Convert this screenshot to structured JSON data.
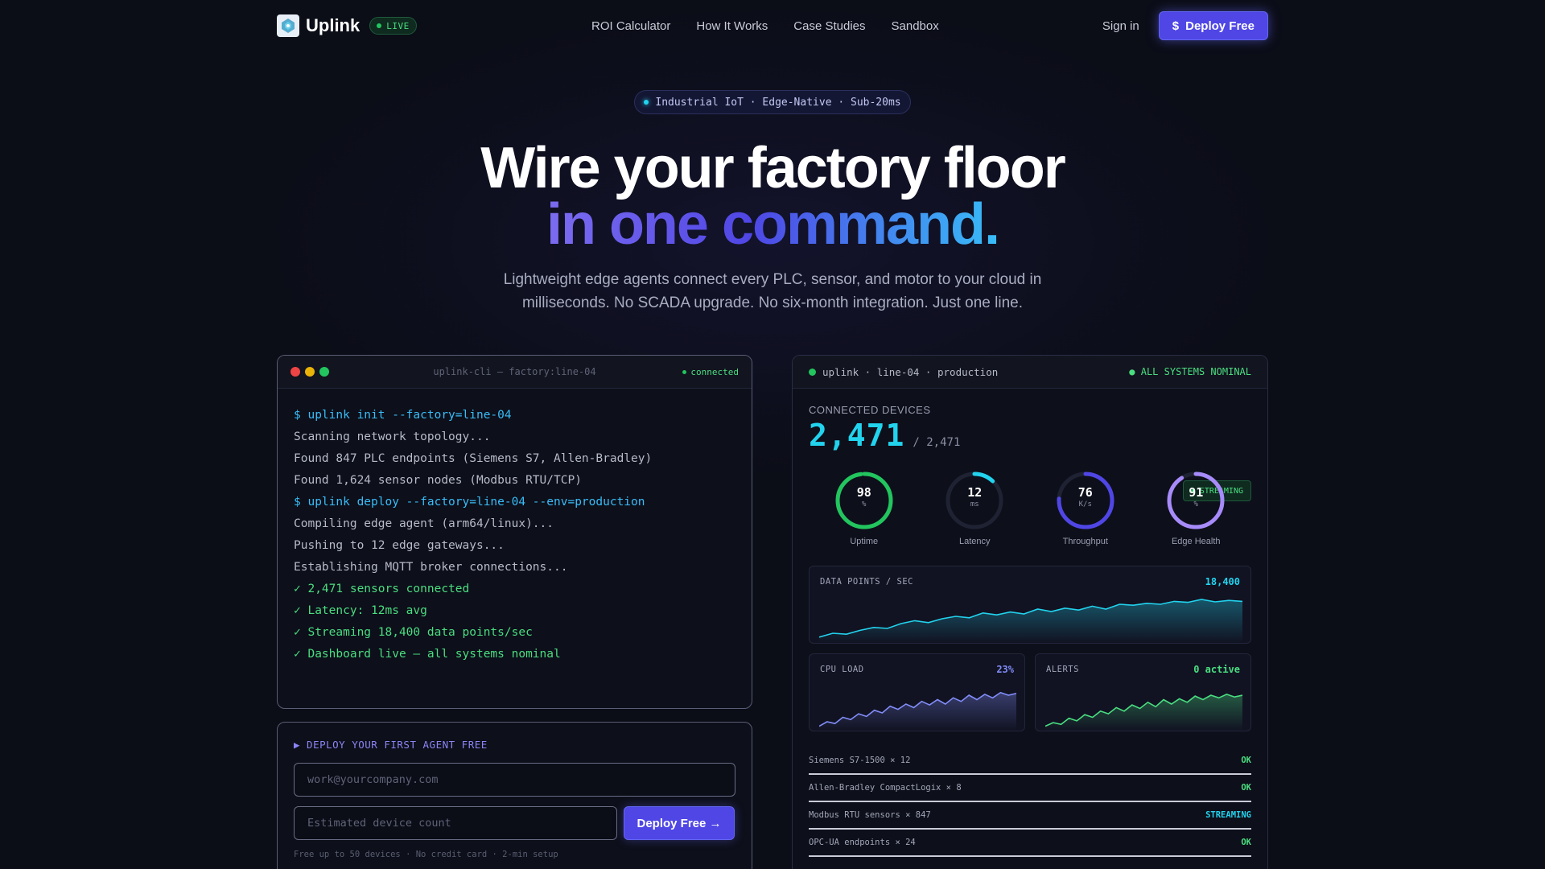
{
  "nav": {
    "brand": "Uplink",
    "live_label": "LIVE",
    "links": [
      "ROI Calculator",
      "How It Works",
      "Case Studies",
      "Sandbox"
    ],
    "signin": "Sign in",
    "deploy_icon": "$",
    "deploy_label": "Deploy Free"
  },
  "hero": {
    "pill": "Industrial IoT · Edge-Native · Sub-20ms",
    "title_line1": "Wire your factory floor",
    "title_line2": "in one command.",
    "subtitle": "Lightweight edge agents connect every PLC, sensor, and motor to your cloud in milliseconds. No SCADA upgrade. No six-month integration. Just one line."
  },
  "terminal": {
    "title": "uplink-cli — factory:line-04",
    "status": "connected",
    "lines": [
      {
        "type": "cmd",
        "text": "$ uplink init --factory=line-04"
      },
      {
        "type": "out",
        "text": "Scanning network topology..."
      },
      {
        "type": "out",
        "text": "Found 847 PLC endpoints (Siemens S7, Allen-Bradley)"
      },
      {
        "type": "out",
        "text": "Found 1,624 sensor nodes (Modbus RTU/TCP)"
      },
      {
        "type": "cmd",
        "text": "$ uplink deploy --factory=line-04 --env=production"
      },
      {
        "type": "out",
        "text": "Compiling edge agent (arm64/linux)..."
      },
      {
        "type": "out",
        "text": "Pushing to 12 edge gateways..."
      },
      {
        "type": "out",
        "text": "Establishing MQTT broker connections..."
      },
      {
        "type": "ok",
        "text": "✓ 2,471 sensors connected"
      },
      {
        "type": "ok",
        "text": "✓ Latency: 12ms avg"
      },
      {
        "type": "ok",
        "text": "✓ Streaming 18,400 data points/sec"
      },
      {
        "type": "ok",
        "text": "✓ Dashboard live — all systems nominal"
      }
    ]
  },
  "form": {
    "title": "▶ DEPLOY YOUR FIRST AGENT FREE",
    "email_placeholder": "work@yourcompany.com",
    "count_placeholder": "Estimated device count",
    "button": "Deploy Free →",
    "note": "Free up to 50 devices · No credit card · 2-min setup"
  },
  "dashboard": {
    "title": "uplink · line-04 · production",
    "status": "● ALL SYSTEMS NOMINAL",
    "connected_label": "CONNECTED DEVICES",
    "connected_value": "2,471",
    "connected_total": "/ 2,471",
    "streaming_badge": "STREAMING",
    "gauges": [
      {
        "value": "98",
        "unit": "%",
        "label": "Uptime",
        "fraction": 0.98,
        "color": "#22c55e"
      },
      {
        "value": "12",
        "unit": "ms",
        "label": "Latency",
        "fraction": 0.12,
        "color": "#22d3ee"
      },
      {
        "value": "76",
        "unit": "K/s",
        "label": "Throughput",
        "fraction": 0.76,
        "color": "#4f46e5"
      },
      {
        "value": "91",
        "unit": "%",
        "label": "Edge Health",
        "fraction": 0.91,
        "color": "#a78bfa"
      }
    ],
    "data_points": {
      "label": "DATA POINTS / SEC",
      "value": "18,400",
      "color": "#22d3ee"
    },
    "cpu": {
      "label": "CPU LOAD",
      "value": "23%",
      "color": "#818cf8"
    },
    "alerts": {
      "label": "ALERTS",
      "value": "0 active",
      "color": "#4ade80"
    },
    "devices": [
      {
        "name": "Siemens S7-1500 × 12",
        "status": "OK",
        "color": "#4ade80"
      },
      {
        "name": "Allen-Bradley CompactLogix × 8",
        "status": "OK",
        "color": "#4ade80"
      },
      {
        "name": "Modbus RTU sensors × 847",
        "status": "STREAMING",
        "color": "#22d3ee"
      },
      {
        "name": "OPC-UA endpoints × 24",
        "status": "OK",
        "color": "#4ade80"
      }
    ]
  },
  "colors": {
    "accent": "#4f46e5",
    "cyan": "#22d3ee",
    "green": "#4ade80",
    "background": "#0b0d17"
  }
}
